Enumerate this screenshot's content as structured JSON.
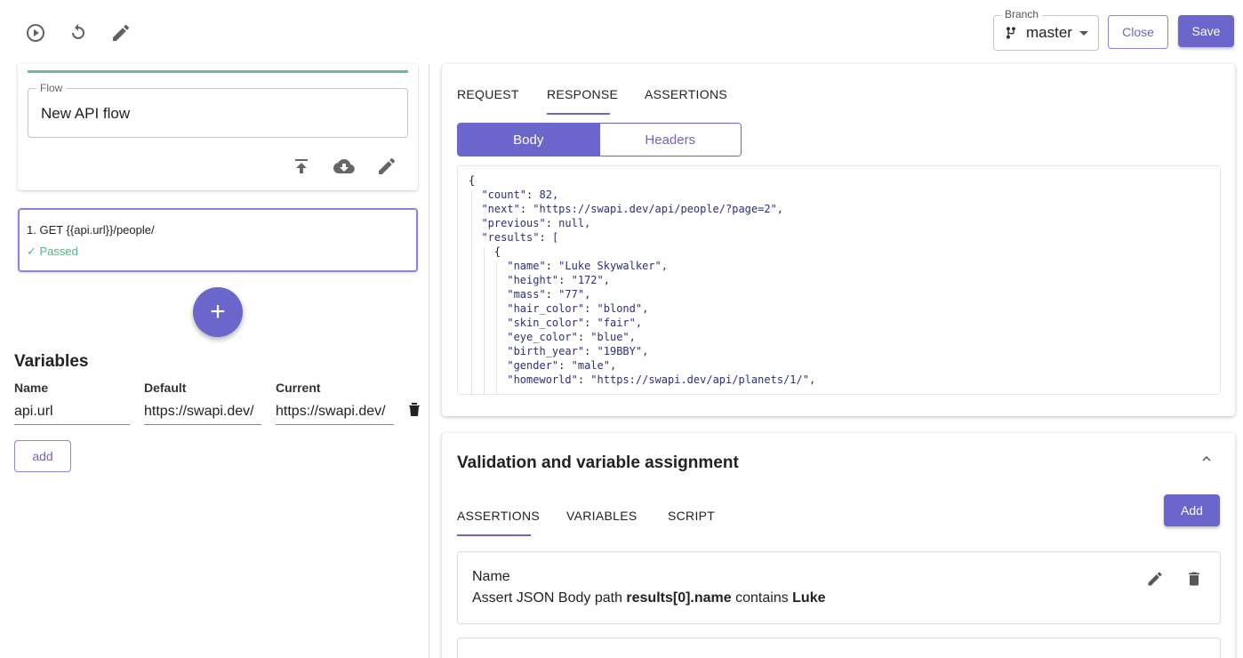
{
  "toolbar": {
    "run_icon": "play-circle-icon",
    "reset_icon": "reset-icon",
    "edit_icon": "pencil-icon",
    "branch_label": "Branch",
    "branch_value": "master",
    "close_label": "Close",
    "save_label": "Save"
  },
  "flow": {
    "field_label": "Flow",
    "name": "New API flow",
    "actions": [
      "upload-icon",
      "cloud-download-icon",
      "pencil-icon"
    ]
  },
  "step": {
    "title": "1. GET {{api.url}}/people/",
    "status": "✓ Passed"
  },
  "variables": {
    "title": "Variables",
    "headers": [
      "Name",
      "Default",
      "Current"
    ],
    "rows": [
      {
        "name": "api.url",
        "default": "https://swapi.dev/",
        "current": "https://swapi.dev/"
      }
    ],
    "add_label": "add"
  },
  "response_panel": {
    "tabs": [
      "REQUEST",
      "RESPONSE",
      "ASSERTIONS"
    ],
    "active_tab": "RESPONSE",
    "segments": [
      "Body",
      "Headers"
    ],
    "active_segment": "Body",
    "body_lines": [
      "{",
      "  \"count\": 82,",
      "  \"next\": \"https://swapi.dev/api/people/?page=2\",",
      "  \"previous\": null,",
      "  \"results\": [",
      "    {",
      "      \"name\": \"Luke Skywalker\",",
      "      \"height\": \"172\",",
      "      \"mass\": \"77\",",
      "      \"hair_color\": \"blond\",",
      "      \"skin_color\": \"fair\",",
      "      \"eye_color\": \"blue\",",
      "      \"birth_year\": \"19BBY\",",
      "      \"gender\": \"male\",",
      "      \"homeworld\": \"https://swapi.dev/api/planets/1/\","
    ]
  },
  "validation": {
    "title": "Validation and variable assignment",
    "tabs": [
      "ASSERTIONS",
      "VARIABLES",
      "SCRIPT"
    ],
    "active_tab": "ASSERTIONS",
    "add_label": "Add",
    "assertion": {
      "name": "Name",
      "prefix": "Assert JSON Body path ",
      "path": "results[0].name",
      "middle": " contains ",
      "value": "Luke"
    }
  },
  "colors": {
    "accent": "#6b66cc",
    "success": "#5bae86",
    "progress": "#6fb89a"
  }
}
